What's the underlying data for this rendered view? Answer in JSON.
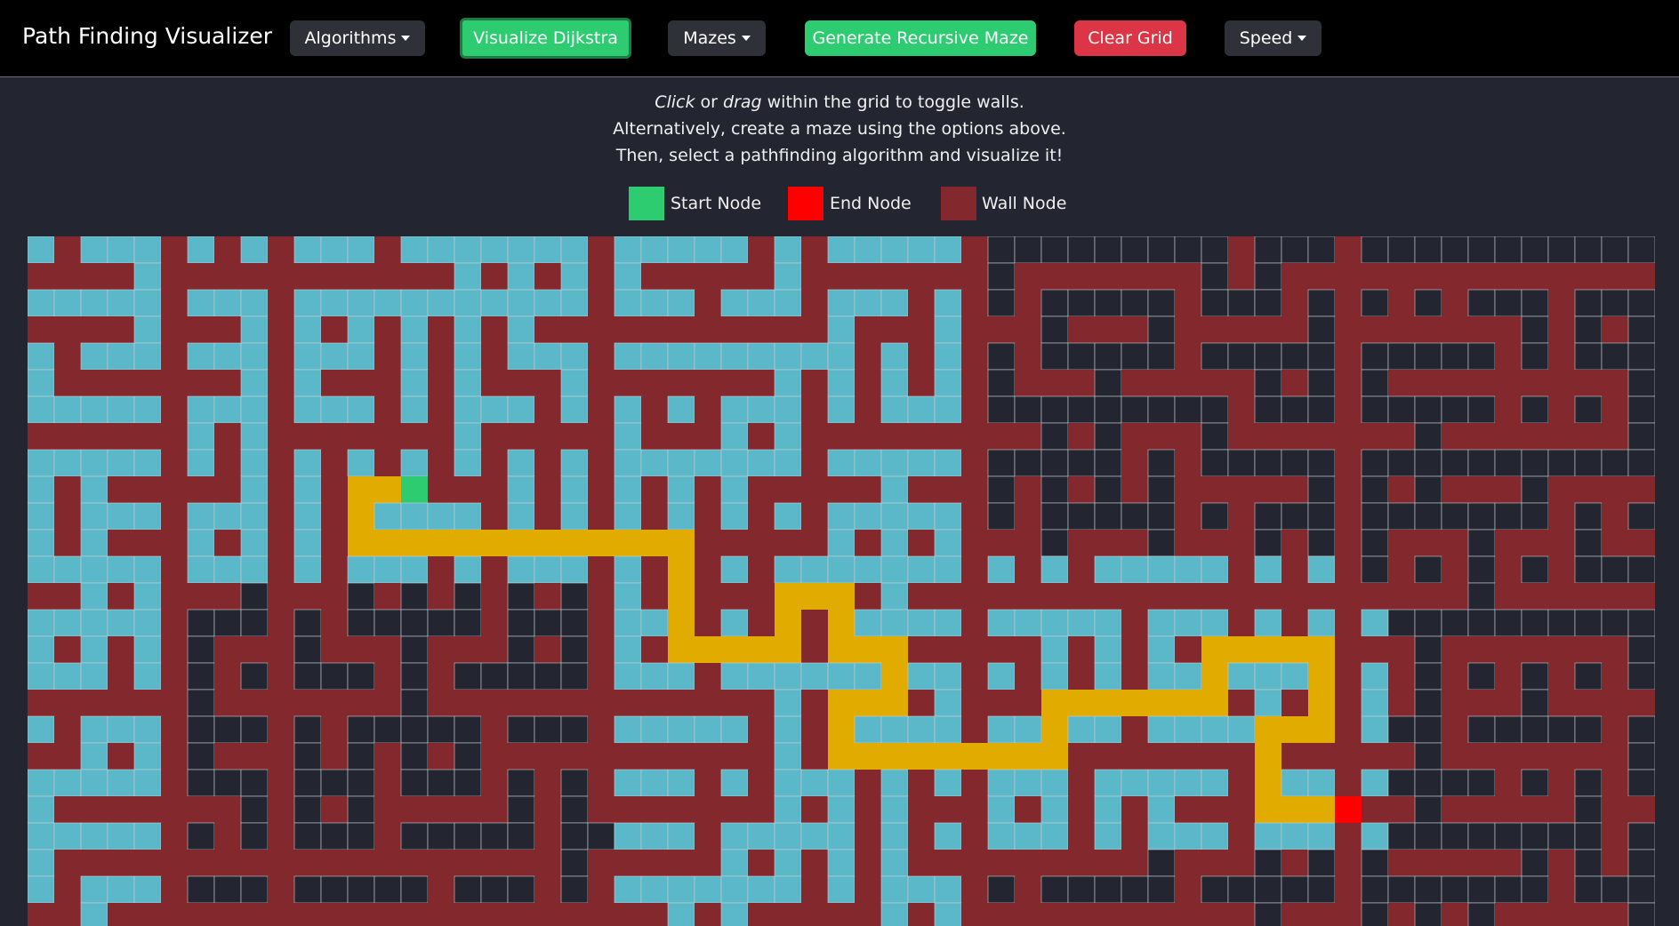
{
  "navbar": {
    "brand": "Path Finding Visualizer",
    "algorithms_label": "Algorithms",
    "visualize_label": "Visualize Dijkstra",
    "mazes_label": "Mazes",
    "generate_label": "Generate Recursive Maze",
    "clear_label": "Clear Grid",
    "speed_label": "Speed"
  },
  "instructions": {
    "line1_click": "Click",
    "line1_or": "or",
    "line1_drag": "drag",
    "line1_rest": "within the grid to toggle walls.",
    "line2": "Alternatively, create a maze using the options above.",
    "line3": "Then, select a pathfinding algorithm and visualize it!"
  },
  "legend": {
    "start_label": "Start Node",
    "end_label": "End Node",
    "wall_label": "Wall Node"
  },
  "colors": {
    "start": "#2ecc71",
    "end": "#ff0000",
    "wall": "#83292d",
    "visited": "#5ab8c8",
    "path": "#e1ab00",
    "empty": "#232630",
    "grid_line": "#c8ccd4"
  },
  "grid": {
    "cols": 61,
    "rows": 26,
    "start": [
      14,
      9
    ],
    "end": [
      49,
      21
    ]
  }
}
